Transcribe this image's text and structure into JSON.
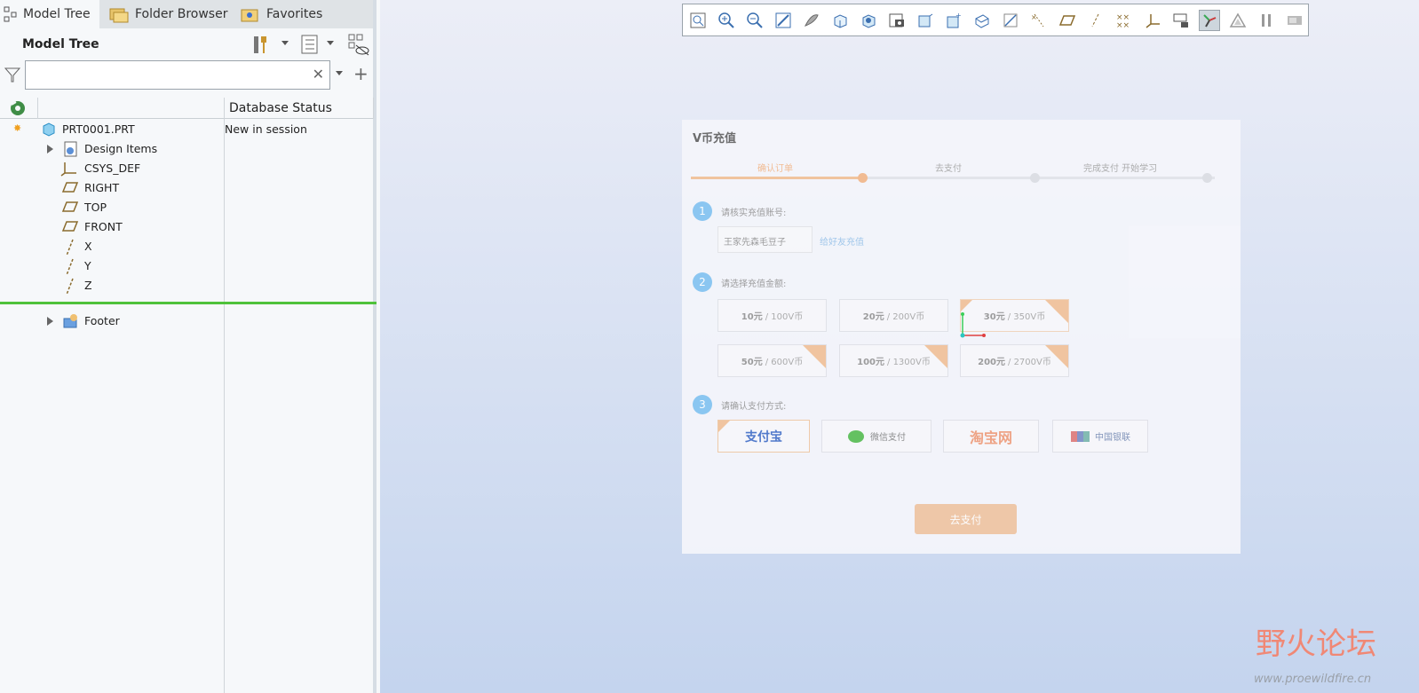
{
  "tabs": [
    {
      "label": "Model Tree",
      "icon": "model-tree-icon"
    },
    {
      "label": "Folder Browser",
      "icon": "folder-browser-icon"
    },
    {
      "label": "Favorites",
      "icon": "favorites-icon"
    }
  ],
  "model_tree": {
    "title": "Model Tree",
    "search_value": "",
    "column_header": "Database Status",
    "root": {
      "label": "PRT0001.PRT",
      "status": "New in session"
    },
    "items": [
      {
        "label": "Design Items"
      },
      {
        "label": "CSYS_DEF"
      },
      {
        "label": "RIGHT"
      },
      {
        "label": "TOP"
      },
      {
        "label": "FRONT"
      },
      {
        "label": "X"
      },
      {
        "label": "Y"
      },
      {
        "label": "Z"
      }
    ],
    "footer": "Footer"
  },
  "colors": {
    "accent": "#4fc23a",
    "orange": "#f1c39a",
    "blue": "#87c5f1"
  },
  "overlay": {
    "title": "V币充值",
    "steps": [
      "确认订单",
      "去支付",
      "完成支付 开始学习"
    ],
    "sec1": "请核实充值账号:",
    "account": "王家先森毛豆子",
    "friend_link": "给好友充值",
    "sec2": "请选择充值金额:",
    "amounts": [
      {
        "price": "10元",
        "coins": "/ 100V币"
      },
      {
        "price": "20元",
        "coins": "/ 200V币"
      },
      {
        "price": "30元",
        "coins": "/ 350V币"
      },
      {
        "price": "50元",
        "coins": "/ 600V币"
      },
      {
        "price": "100元",
        "coins": "/ 1300V币"
      },
      {
        "price": "200元",
        "coins": "/ 2700V币"
      }
    ],
    "sec3": "请确认支付方式:",
    "pay_methods": [
      "支付宝",
      "微信支付",
      "淘宝网",
      "中国银联"
    ],
    "pay_button": "去支付"
  },
  "watermark": {
    "title": "野火论坛",
    "url": "www.proewildfire.cn"
  }
}
